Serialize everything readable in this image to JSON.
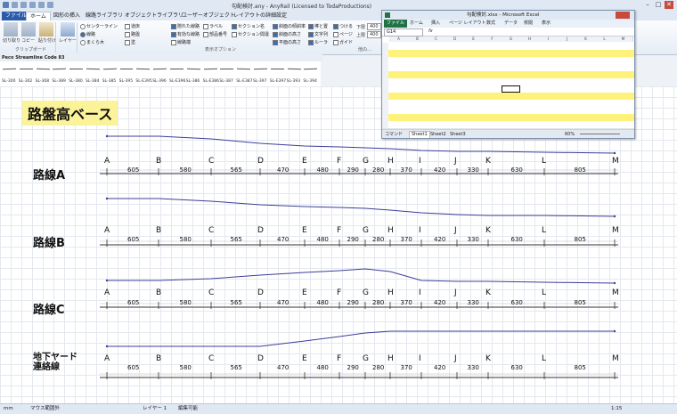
{
  "window": {
    "title": "勾配検討.any - AnyRail (Licensed to TodaProductions)",
    "minimize": "–",
    "maximize": "□",
    "close": "✕"
  },
  "ribbon_tabs": [
    "ファイル",
    "ホーム",
    "図形の挿入",
    "線路ライブラリ",
    "オブジェクトライブラリ",
    "ユーザーオブジェクト",
    "レイアウトの詳細設定"
  ],
  "ribbon": {
    "clipboard": {
      "cut": "切り取り",
      "copy": "コピー",
      "paste": "貼り付け",
      "group": "クリップボード"
    },
    "layer": {
      "label": "レイヤー",
      "group": ""
    },
    "radios": [
      "センターライン",
      "線路",
      "まくら木"
    ],
    "checks_col1": [
      "道床",
      "路盤",
      "塗"
    ],
    "checks_col2": [
      "隠れた線路",
      "有効な線路",
      "線路端"
    ],
    "checks_col3": [
      "ラベル",
      "部品番号"
    ],
    "checks_col4": [
      "セクション名",
      "セクション間違"
    ],
    "checks_col5": [
      "斜面の傾斜率",
      "斜面の高さ",
      "平面の高さ"
    ],
    "checks_col6": [
      "棒と置",
      "文字列",
      "ルーラ"
    ],
    "checks_col7": [
      "つける",
      "ページ",
      "ガイド"
    ],
    "lower_label": "下限",
    "lower_value": "400",
    "upper_label": "上限",
    "upper_value": "400",
    "display_group": "表示オプション",
    "other_group": "他の…"
  },
  "library": {
    "title": "Peco Streamline Code 83",
    "items": [
      "SL-300",
      "SL-302",
      "SL-308",
      "SL-389",
      "SL-380",
      "SL-384",
      "SL-385",
      "SL-395",
      "SL-E395",
      "SL-396",
      "SL-E396",
      "SL-386",
      "SL-E386",
      "SL-387",
      "SL-E387",
      "SL-397",
      "SL-E397",
      "SL-393",
      "SL-394"
    ]
  },
  "canvas": {
    "title": "路盤高ベース",
    "stations": [
      "A",
      "B",
      "C",
      "D",
      "E",
      "F",
      "G",
      "H",
      "I",
      "J",
      "K",
      "L",
      "M"
    ],
    "distances": [
      "605",
      "580",
      "565",
      "470",
      "480",
      "290",
      "280",
      "370",
      "420",
      "330",
      "630",
      "805"
    ],
    "lines": [
      {
        "name": "路線A"
      },
      {
        "name": "路線B"
      },
      {
        "name": "路線C"
      },
      {
        "name": "地下ヤード連絡線",
        "name_line1": "地下ヤード",
        "name_line2": "連絡線"
      }
    ]
  },
  "excel": {
    "title": "勾配検討.xlsx - Microsoft Excel",
    "tabs": [
      "ファイル",
      "ホーム",
      "挿入",
      "ページ レイアウト",
      "数式",
      "データ",
      "校閲",
      "表示"
    ],
    "namebox": "G14",
    "formula_icon": "fx",
    "columns": [
      "A",
      "B",
      "C",
      "D",
      "E",
      "F",
      "G",
      "H",
      "I",
      "J",
      "K",
      "L",
      "M"
    ],
    "sheets": [
      "Sheet1",
      "Sheet2",
      "Sheet3"
    ],
    "status_left": "コマンド",
    "zoom": "60%"
  },
  "status": {
    "left": "mm",
    "mouse": "マウス範囲外",
    "layer": "レイヤー 1",
    "edit": "編集可能",
    "scale": "1:15"
  }
}
